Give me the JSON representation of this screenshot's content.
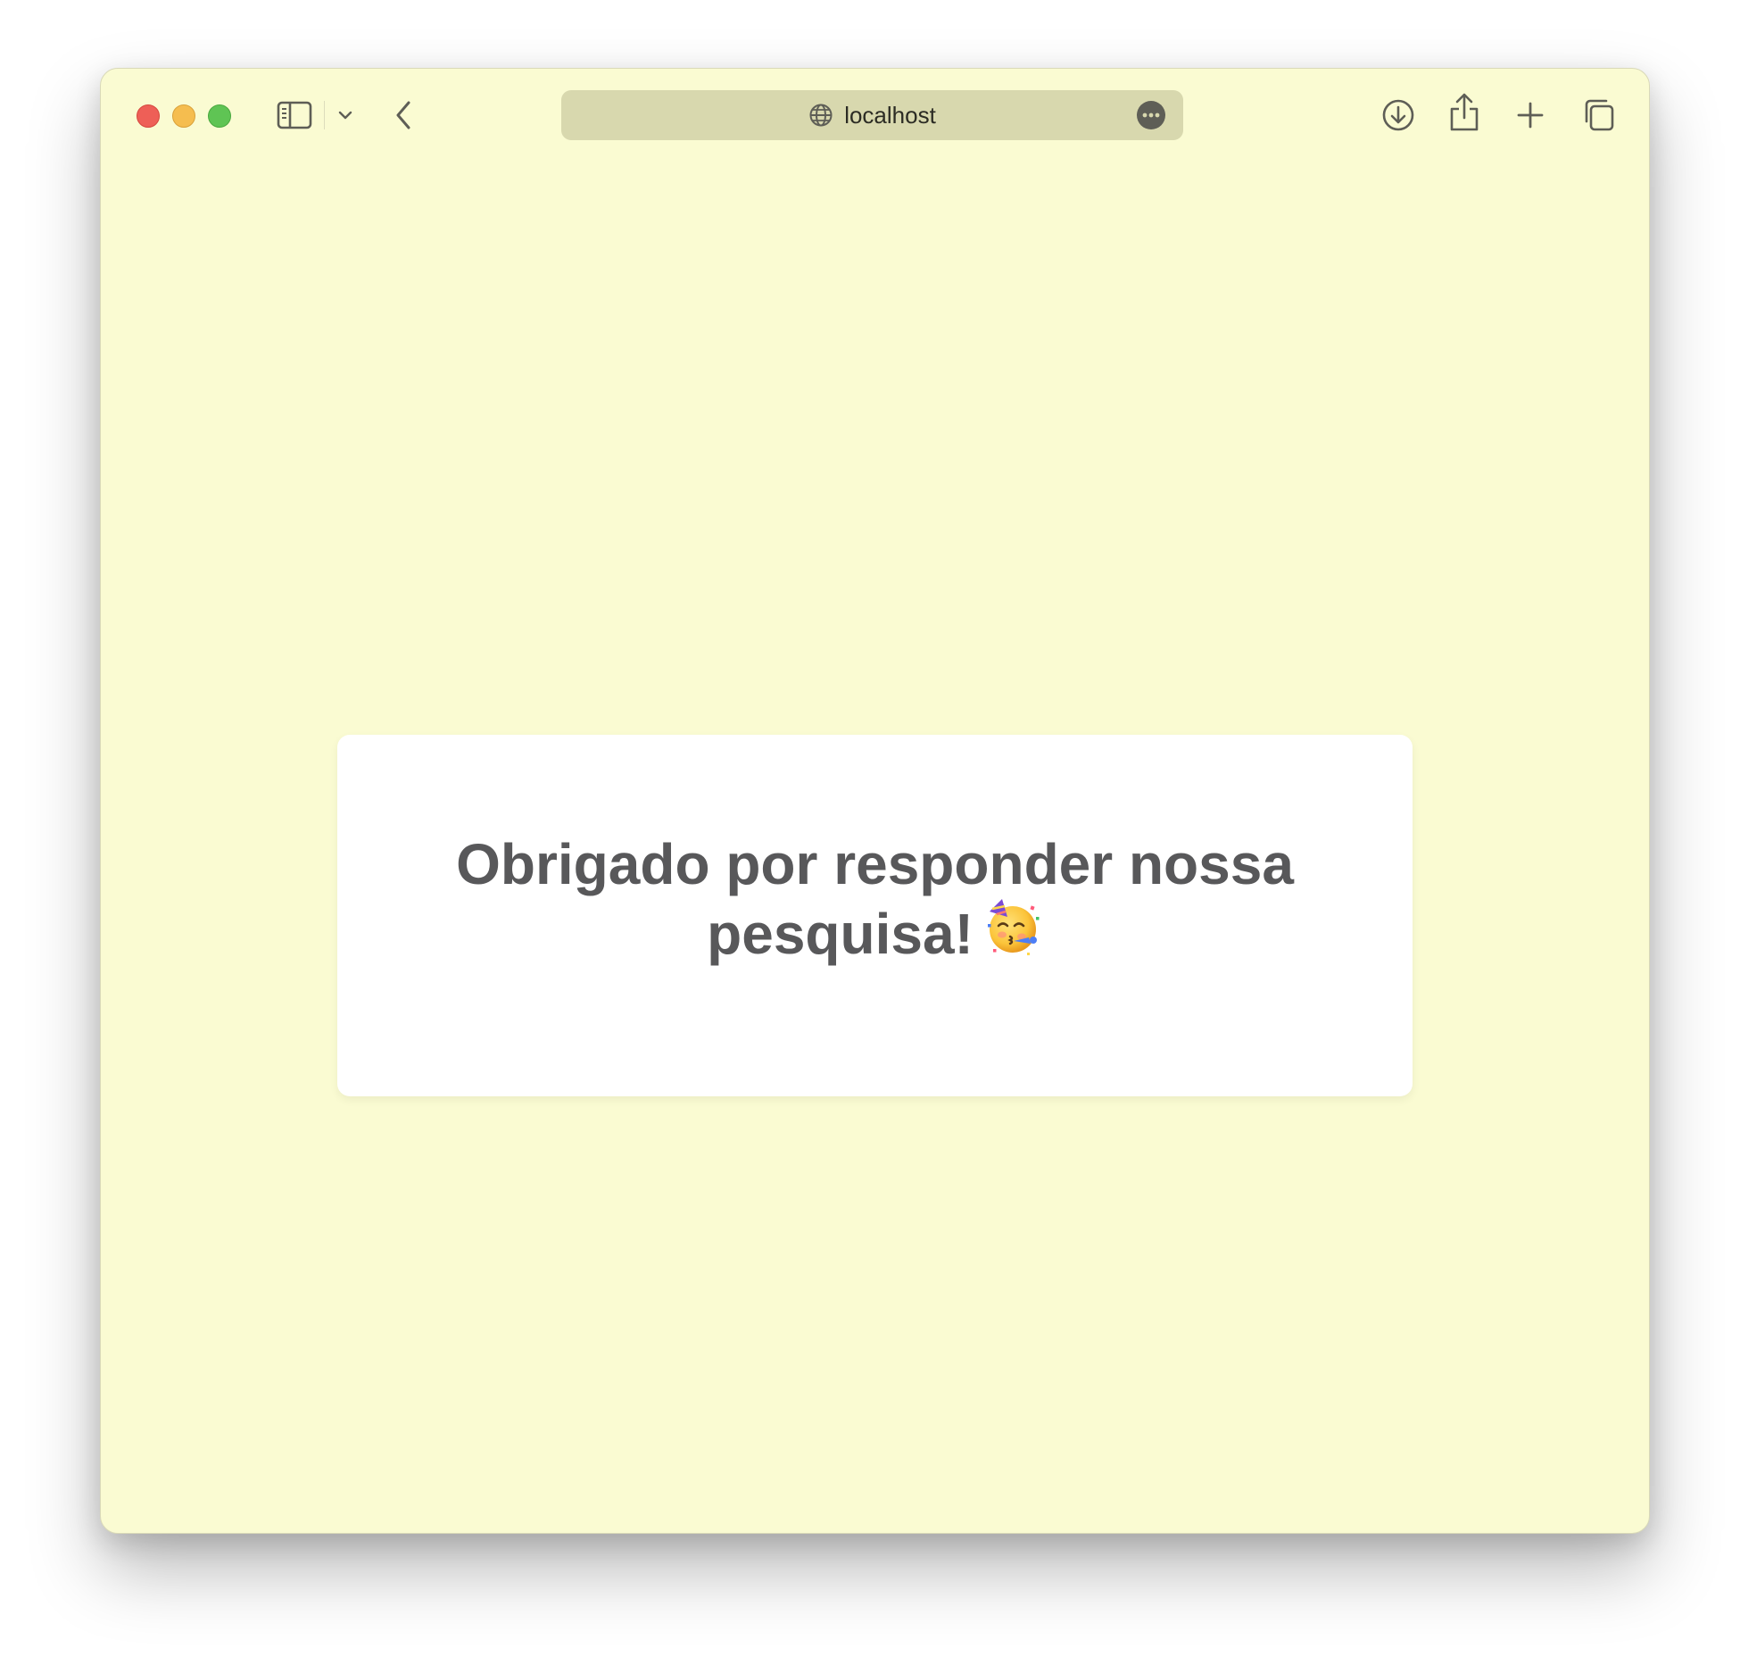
{
  "browser": {
    "address": {
      "url": "localhost",
      "globe_icon": "globe-icon",
      "more_icon": "ellipsis-circle-icon"
    },
    "toolbar_icons": [
      "sidebar-icon",
      "chevron-down-icon",
      "back-arrow-icon",
      "download-icon",
      "share-icon",
      "plus-icon",
      "tabs-overview-icon"
    ],
    "traffic_lights": {
      "close": "#ee5f57",
      "minimize": "#f5bd4f",
      "maximize": "#5fc454"
    }
  },
  "page": {
    "background": "#fafbd2",
    "card": {
      "message": "Obrigado por responder nossa pesquisa!",
      "emoji_icon": "partying-face-icon",
      "text_color": "#58585a"
    }
  }
}
